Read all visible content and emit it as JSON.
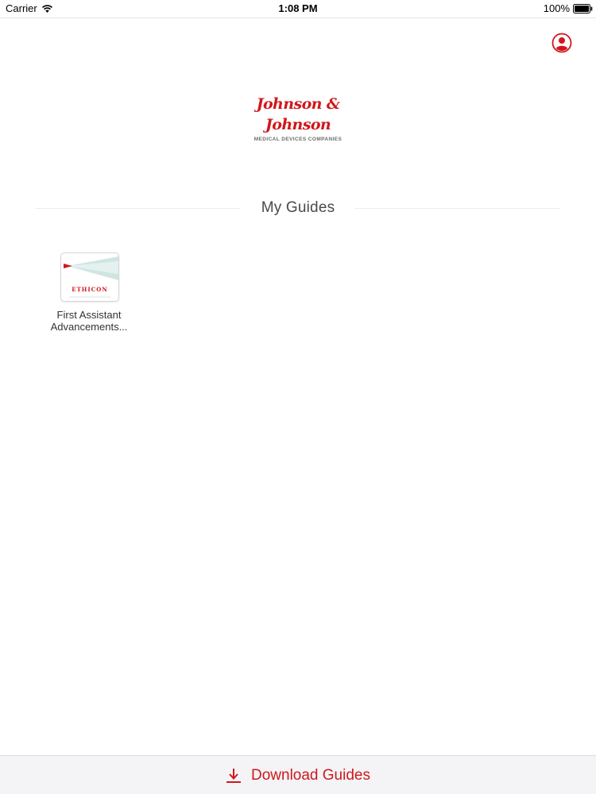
{
  "status_bar": {
    "carrier": "Carrier",
    "time": "1:08 PM",
    "battery": "100%",
    "icons": [
      "wifi-icon",
      "battery-icon"
    ]
  },
  "header": {
    "profile_icon": "user-profile-icon",
    "logo": {
      "script": "Johnson & Johnson",
      "subtitle": "MEDICAL DEVICES COMPANIES"
    }
  },
  "main": {
    "section_title": "My Guides",
    "guides": [
      {
        "brand": "ETHICON",
        "title_line1": "First Assistant",
        "title_line2": "Advancements..."
      }
    ]
  },
  "toolbar": {
    "download_label": "Download Guides",
    "download_icon": "download-icon"
  },
  "colors": {
    "accent": "#d1171b",
    "toolbar_bg": "#f4f4f6",
    "title_text": "#4a4a4a",
    "thumb_teal": "#cfe5e2"
  }
}
